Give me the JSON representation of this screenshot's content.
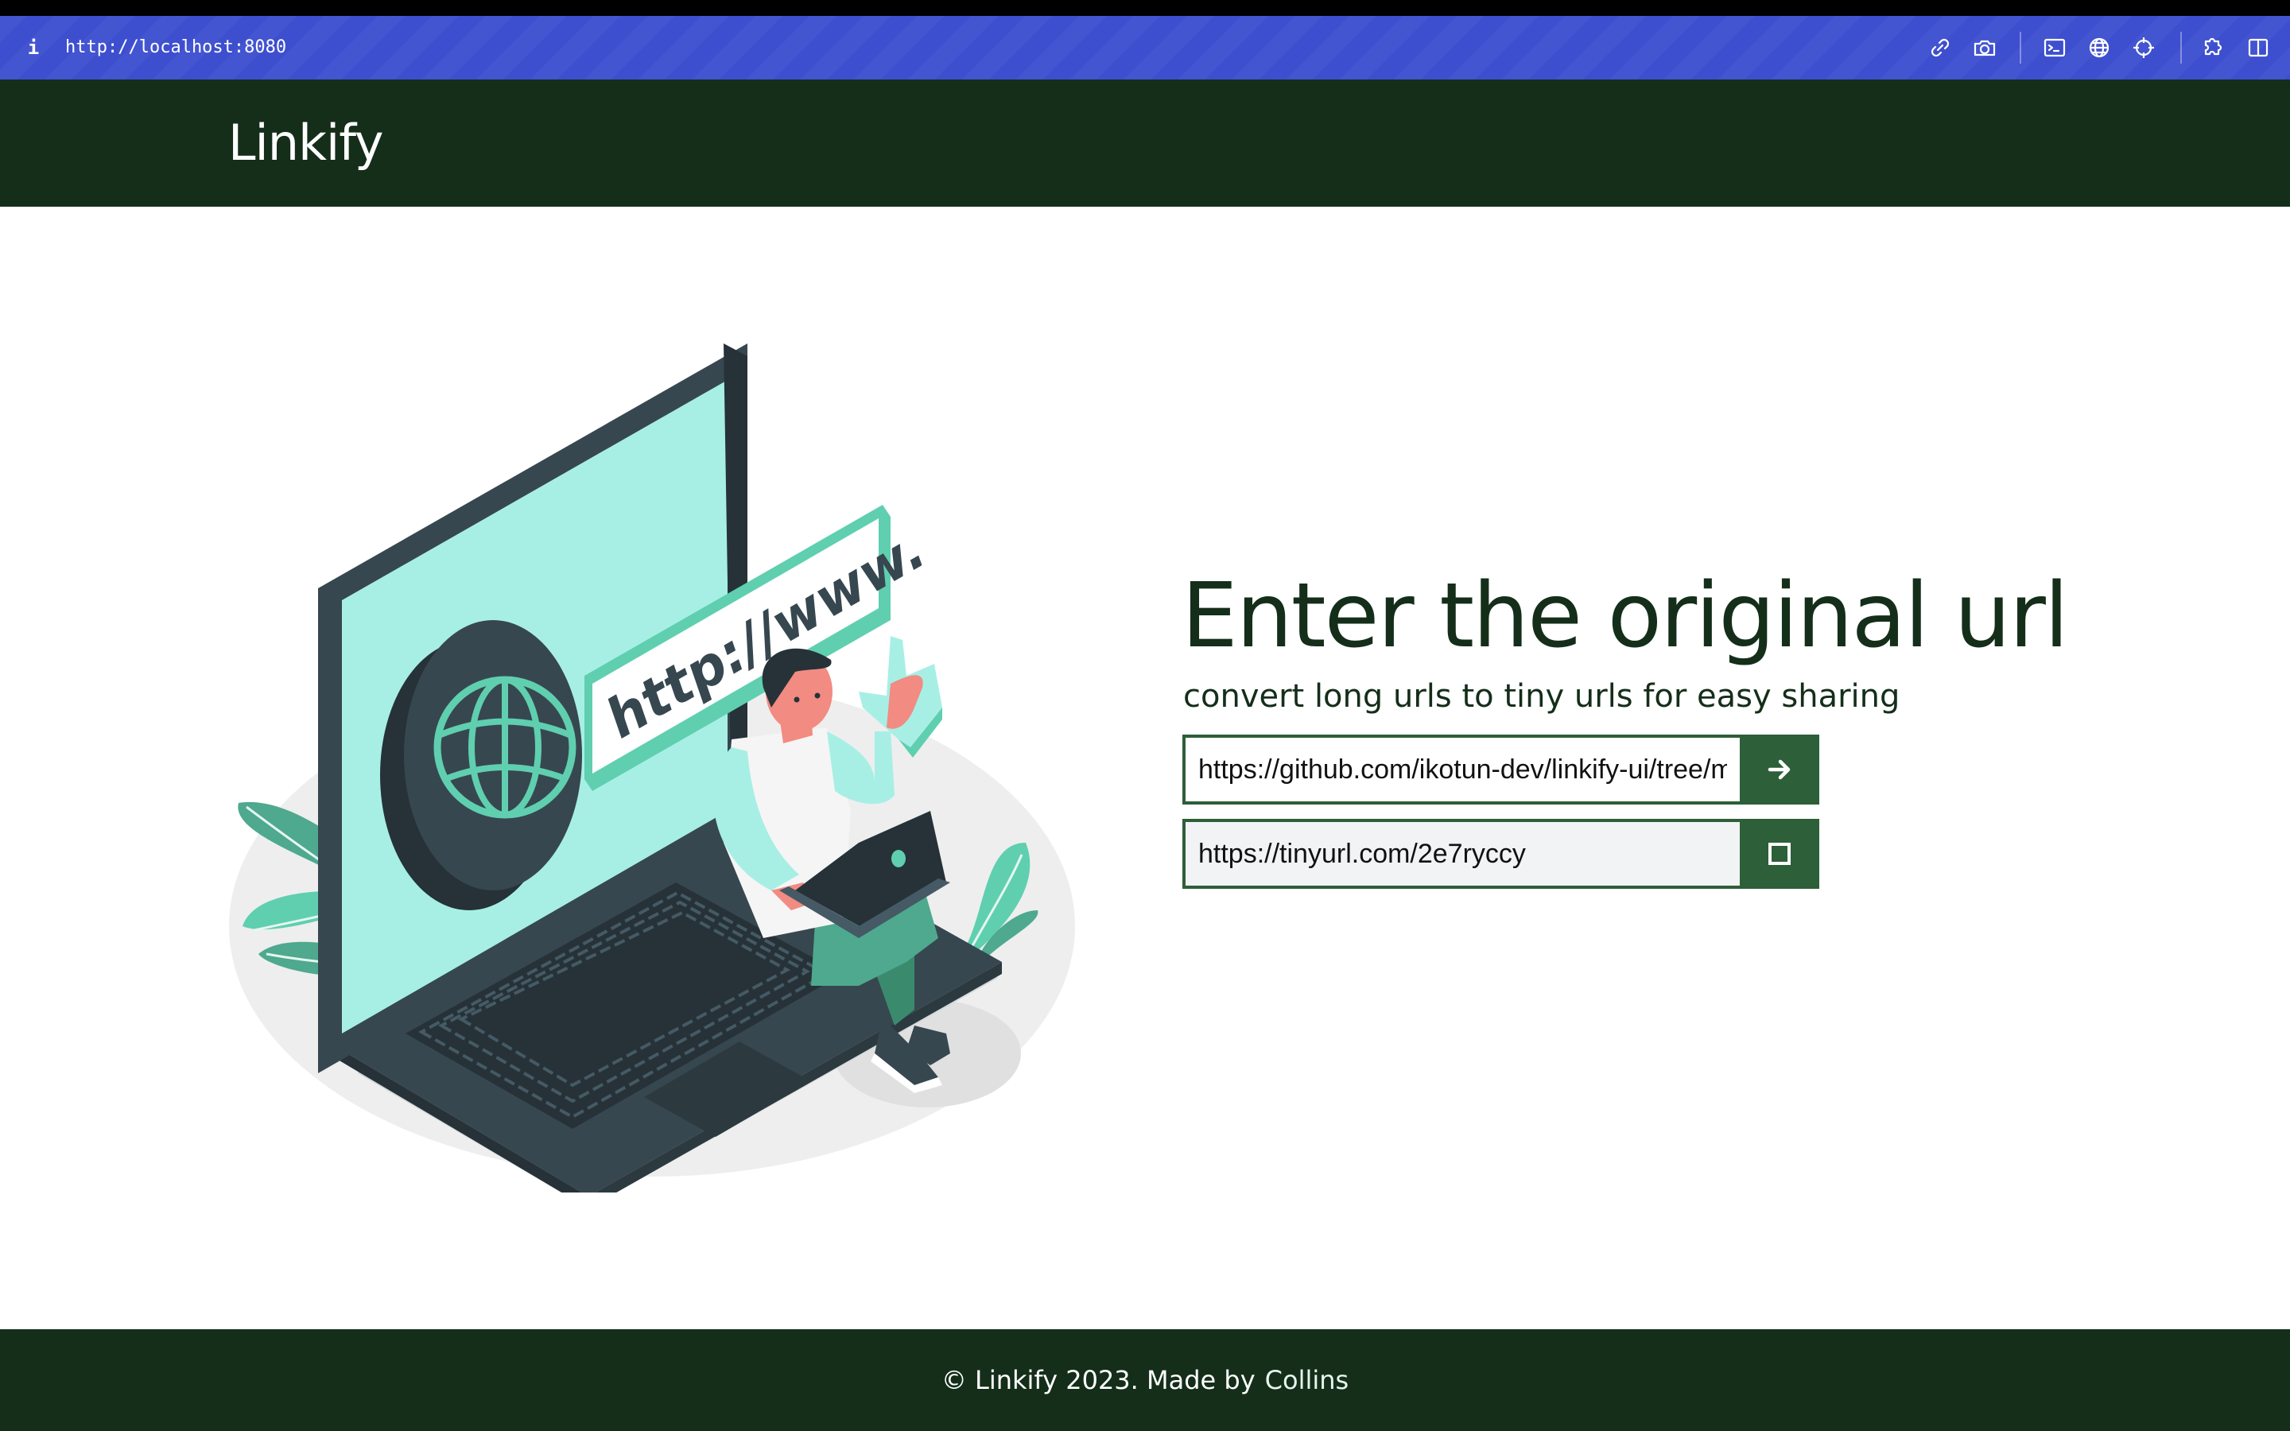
{
  "browser": {
    "info_glyph": "i",
    "url": "http://localhost:8080",
    "toolbar_icons": [
      "link-icon",
      "camera-icon",
      "terminal-icon",
      "globe-icon",
      "crosshair-icon",
      "extensions-icon",
      "sidebar-icon"
    ]
  },
  "header": {
    "logo": "Linkify"
  },
  "hero": {
    "title": "Enter the original url",
    "subtitle": "convert long urls to tiny urls for easy sharing",
    "illustration_text": "http://www."
  },
  "form": {
    "original_url_value": "https://github.com/ikotun-dev/linkify-ui/tree/main",
    "shorten_button_icon": "arrow-right-icon",
    "short_url_value": "https://tinyurl.com/2e7ryccy",
    "copy_button_icon": "copy-icon"
  },
  "footer": {
    "text": "© Linkify 2023. Made by",
    "author_link": "Collins"
  },
  "colors": {
    "browser_bar": "#3d4fcf",
    "header_bg": "#142e1a",
    "accent_green": "#2d5f38",
    "title_text": "#142e1a",
    "illustration_teal": "#5fcfb0",
    "illustration_dark": "#37474f"
  }
}
